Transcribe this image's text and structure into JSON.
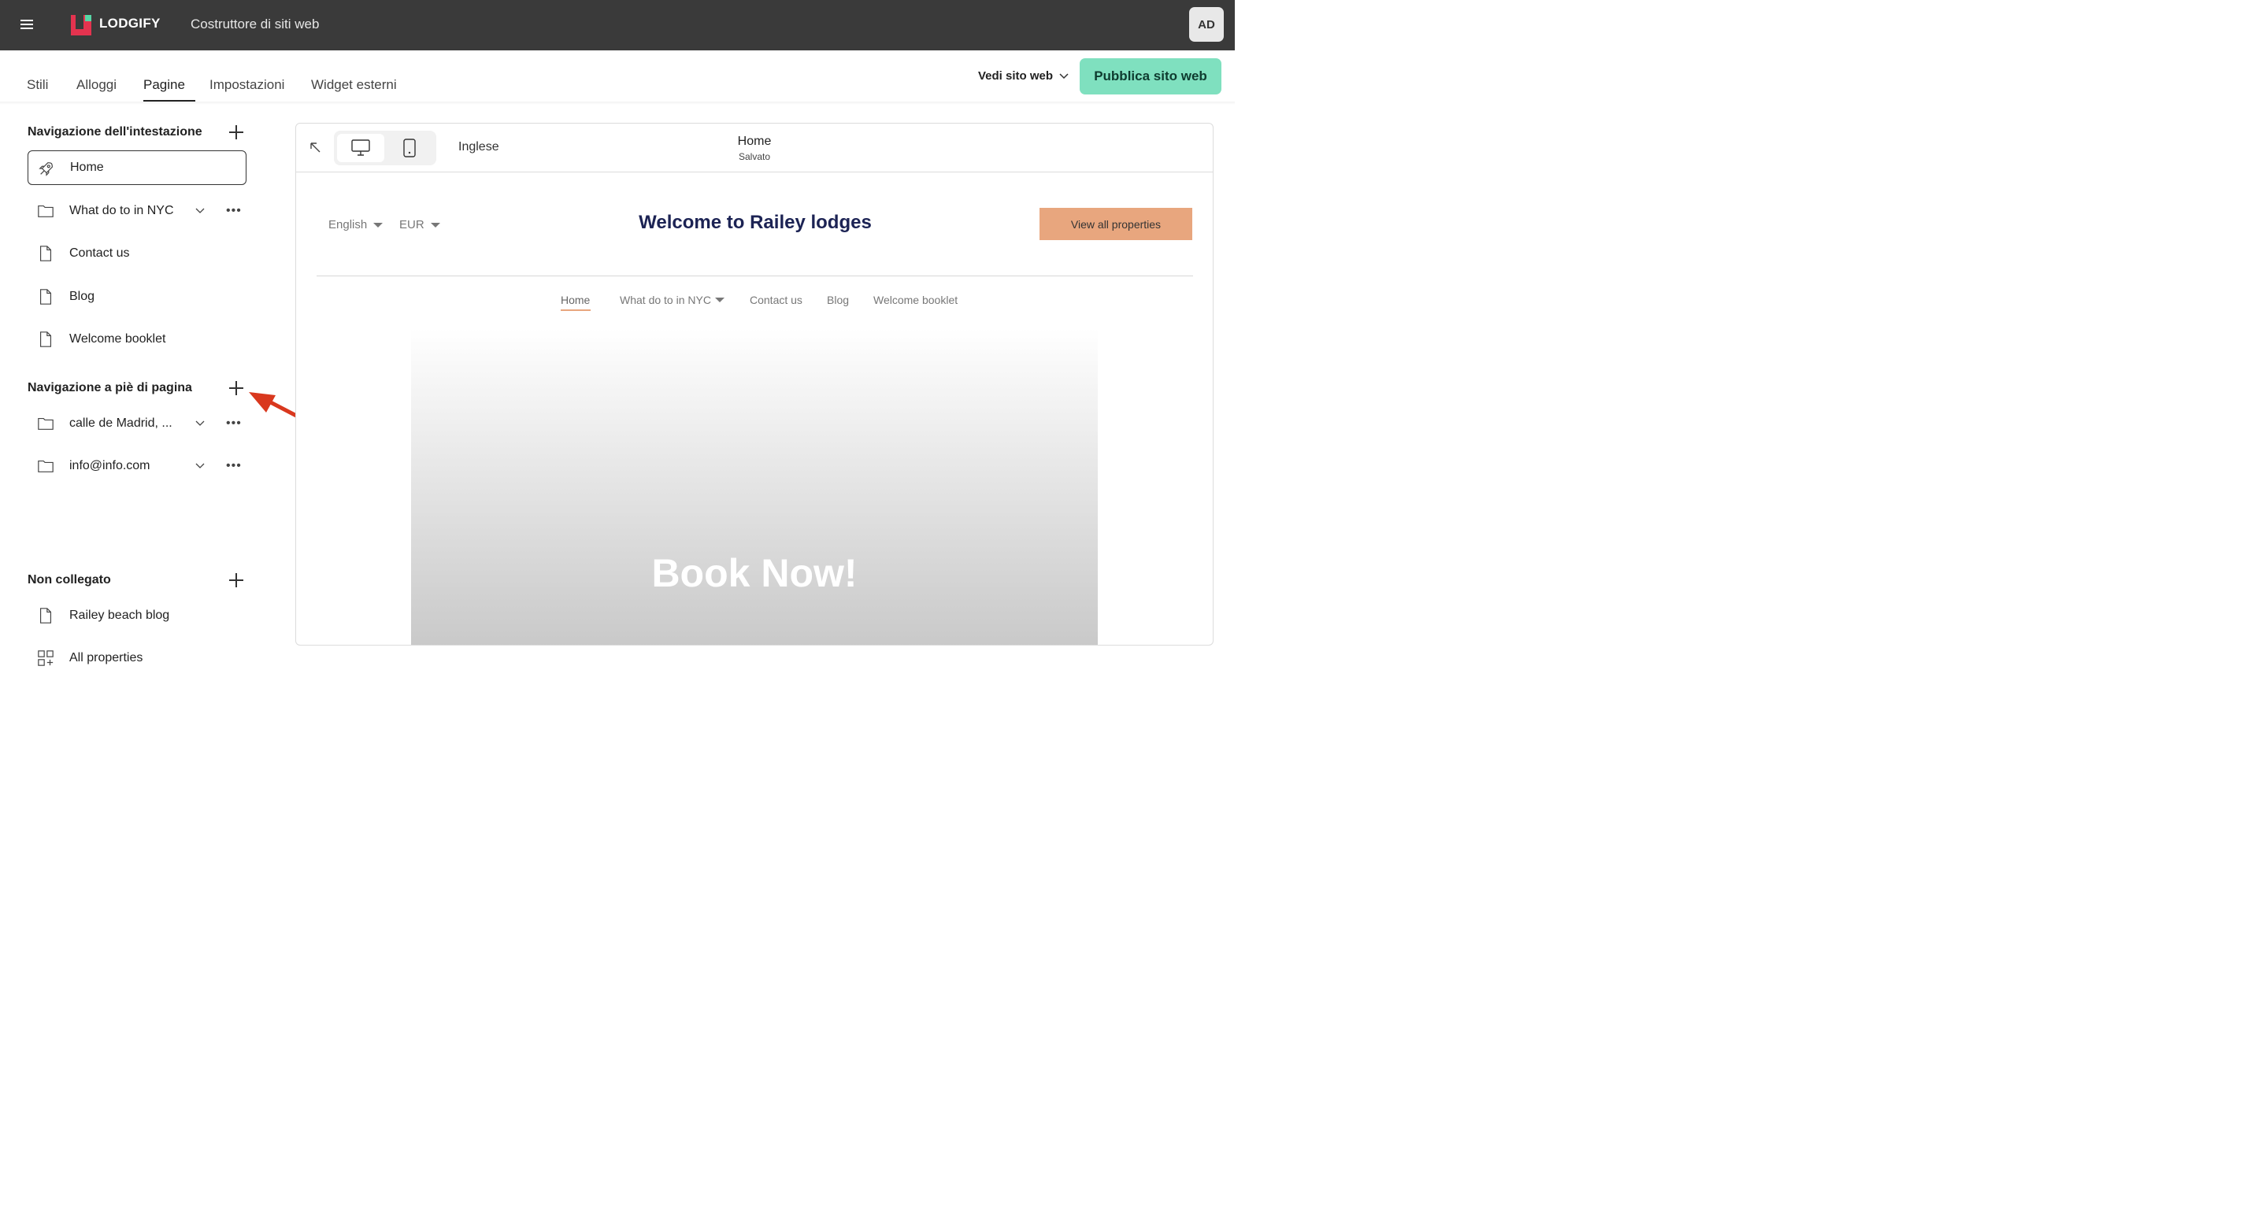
{
  "topbar": {
    "logo_text": "LODGIFY",
    "app_title": "Costruttore di siti web",
    "avatar_initials": "AD"
  },
  "tabs": [
    {
      "label": "Stili"
    },
    {
      "label": "Alloggi"
    },
    {
      "label": "Pagine",
      "active": true
    },
    {
      "label": "Impostazioni"
    },
    {
      "label": "Widget esterni"
    }
  ],
  "actions": {
    "view_site_label": "Vedi sito web",
    "publish_label": "Pubblica sito web"
  },
  "sidebar": {
    "header_nav": {
      "title": "Navigazione dell'intestazione",
      "items": [
        {
          "label": "Home",
          "icon": "rocket-icon",
          "selected": true
        },
        {
          "label": "What do to in NYC",
          "icon": "folder-icon",
          "has_children": true
        },
        {
          "label": "Contact us",
          "icon": "page-icon"
        },
        {
          "label": "Blog",
          "icon": "page-icon"
        },
        {
          "label": "Welcome booklet",
          "icon": "page-icon"
        }
      ]
    },
    "footer_nav": {
      "title": "Navigazione a piè di pagina",
      "items": [
        {
          "label": "calle de Madrid, ...",
          "icon": "folder-icon",
          "has_children": true
        },
        {
          "label": "info@info.com",
          "icon": "folder-icon",
          "has_children": true
        }
      ]
    },
    "unlinked": {
      "title": "Non collegato",
      "items": [
        {
          "label": "Railey beach blog",
          "icon": "page-icon"
        },
        {
          "label": "All properties",
          "icon": "grid-add-icon"
        }
      ]
    }
  },
  "preview": {
    "language": "Inglese",
    "page_name": "Home",
    "status": "Salvato",
    "site": {
      "language_select": "English",
      "currency_select": "EUR",
      "title": "Welcome to Railey lodges",
      "cta": "View all properties",
      "nav": [
        "Home",
        "What do to in NYC",
        "Contact us",
        "Blog",
        "Welcome booklet"
      ],
      "hero_text": "Book Now!"
    }
  },
  "colors": {
    "topbar": "#3a3a3a",
    "publish_button": "#7fe0bf",
    "cta_button": "#e8a67e",
    "site_title": "#1c2354",
    "annotation_arrow": "#d9381e"
  }
}
